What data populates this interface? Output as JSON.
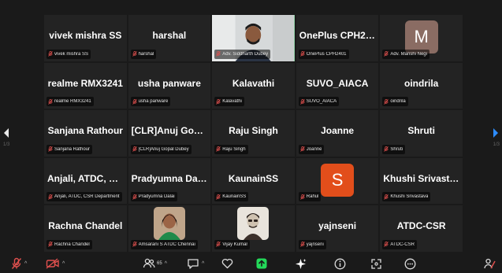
{
  "colors": {
    "background": "#1a1a1a",
    "tile": "#232323",
    "active_speaker": "#23d959",
    "mute_red": "#e0504e",
    "share_green": "#23d959"
  },
  "navigation": {
    "prev_page_label": "1/3",
    "next_page_label": "1/3"
  },
  "participants": [
    {
      "display": "vivek mishra SS",
      "label": "vivek mishra SS",
      "type": "name"
    },
    {
      "display": "harshal",
      "label": "harshal",
      "type": "name"
    },
    {
      "display": "",
      "label": "Adv. Siddharth Dubey",
      "type": "video",
      "active": true
    },
    {
      "display": "OnePlus CPH24...",
      "label": "OnePlus CPH2401",
      "type": "name"
    },
    {
      "display": "M",
      "label": "Adv. Manshi Negi",
      "type": "avatar",
      "avatar_color": "#8a6c63"
    },
    {
      "display": "realme RMX3241",
      "label": "realme RMX3241",
      "type": "name"
    },
    {
      "display": "usha panware",
      "label": "usha panware",
      "type": "name"
    },
    {
      "display": "Kalavathi",
      "label": "Kalavathi",
      "type": "name"
    },
    {
      "display": "SUVO_AIACA",
      "label": "SUVO_AIACA",
      "type": "name"
    },
    {
      "display": "oindrila",
      "label": "oindrila",
      "type": "name"
    },
    {
      "display": "Sanjana Rathour",
      "label": "Sanjana Rathour",
      "type": "name"
    },
    {
      "display": "[CLR]Anuj Gopa...",
      "label": "[CLR]Anuj Gopal Dubey",
      "type": "name"
    },
    {
      "display": "Raju Singh",
      "label": "Raju Singh",
      "type": "name"
    },
    {
      "display": "Joanne",
      "label": "Joanne",
      "type": "name"
    },
    {
      "display": "Shruti",
      "label": "Shruti",
      "type": "name"
    },
    {
      "display": "Anjali, ATDC, C...",
      "label": "Anjali, ATDC, CSR Department",
      "type": "name"
    },
    {
      "display": "Pradyumna Dalai",
      "label": "Pradyumna Dalai",
      "type": "name"
    },
    {
      "display": "KaunainSS",
      "label": "KaunainSS",
      "type": "name"
    },
    {
      "display": "S",
      "label": "Rahul",
      "type": "avatar",
      "avatar_color": "#e24e1b"
    },
    {
      "display": "Khushi Srivastava",
      "label": "Khushi Srivastava",
      "type": "name"
    },
    {
      "display": "Rachna Chandel",
      "label": "Rachna Chandel",
      "type": "name"
    },
    {
      "display": "",
      "label": "Amsarani S ATDC Chennai",
      "type": "photo",
      "photo": "woman"
    },
    {
      "display": "",
      "label": "Vijay Kumar",
      "type": "photo",
      "photo": "sketch"
    },
    {
      "display": "yajnseni",
      "label": "yajnseni",
      "type": "name"
    },
    {
      "display": "ATDC-CSR",
      "label": "ATDC-CSR",
      "type": "name"
    }
  ],
  "toolbar": {
    "participants_count": "65",
    "icons": [
      "muted-mic-icon",
      "stopped-video-icon",
      "participants-icon",
      "chat-icon",
      "reactions-icon",
      "share-screen-icon",
      "ai-companion-icon",
      "info-icon",
      "apps-icon",
      "more-icon",
      "end-icon"
    ]
  }
}
